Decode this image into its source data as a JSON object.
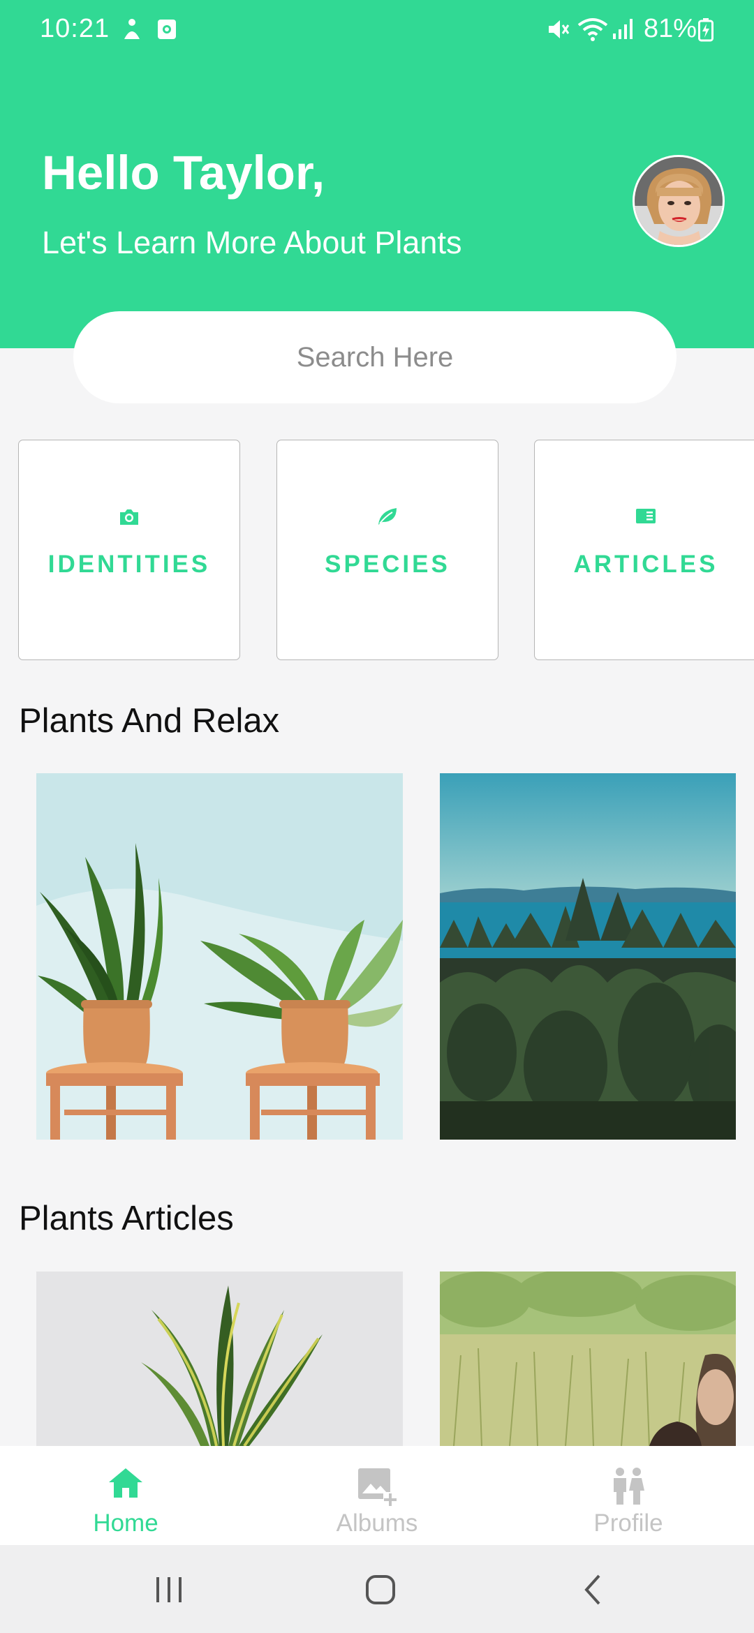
{
  "status_bar": {
    "time": "10:21",
    "battery": "81%"
  },
  "header": {
    "greeting": "Hello Taylor,",
    "subtitle": "Let's Learn More About Plants"
  },
  "search": {
    "placeholder": "Search Here"
  },
  "categories": [
    {
      "label": "IDENTITIES",
      "icon": "camera-icon"
    },
    {
      "label": "SPECIES",
      "icon": "leaf-icon"
    },
    {
      "label": "ARTICLES",
      "icon": "article-icon"
    }
  ],
  "sections": {
    "relax_title": "Plants And Relax",
    "articles_title": "Plants Articles"
  },
  "bottom_nav": [
    {
      "label": "Home",
      "icon": "home-icon",
      "active": true
    },
    {
      "label": "Albums",
      "icon": "add-photo-icon",
      "active": false
    },
    {
      "label": "Profile",
      "icon": "profile-icon",
      "active": false
    }
  ],
  "colors": {
    "accent": "#31d994",
    "inactive": "#c4c4c4",
    "background": "#f5f5f6"
  }
}
